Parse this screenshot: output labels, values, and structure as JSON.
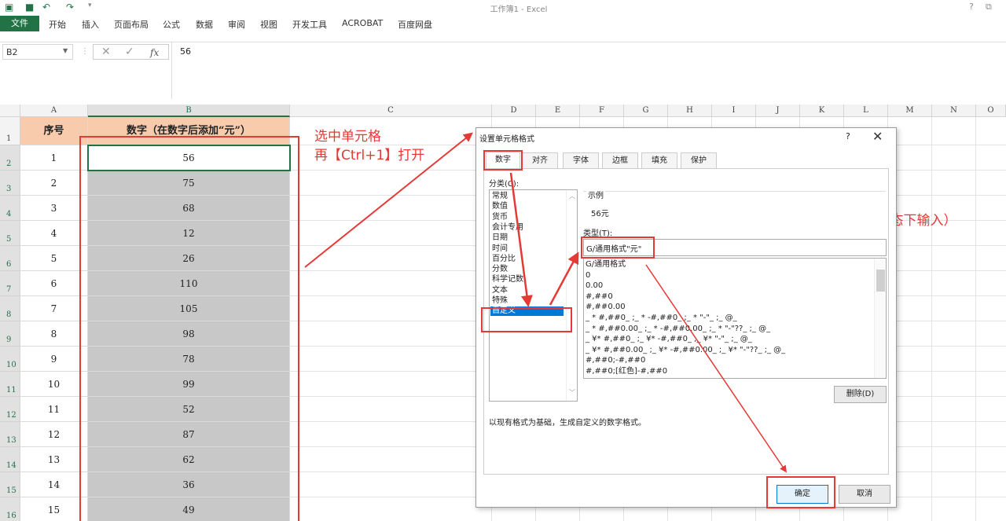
{
  "window": {
    "title": "工作簿1 - Excel"
  },
  "ribbon": {
    "tabs": [
      "文件",
      "开始",
      "插入",
      "页面布局",
      "公式",
      "数据",
      "审阅",
      "视图",
      "开发工具",
      "ACROBAT",
      "百度网盘"
    ]
  },
  "formula_bar": {
    "name_box": "B2",
    "value": "56",
    "fx": "fx"
  },
  "columns": [
    "A",
    "B",
    "C",
    "D",
    "E",
    "F",
    "G",
    "H",
    "I",
    "J",
    "K",
    "L",
    "M",
    "N",
    "O"
  ],
  "rows": [
    "1",
    "2",
    "3",
    "4",
    "5",
    "6",
    "7",
    "8",
    "9",
    "10",
    "11",
    "12",
    "13",
    "14",
    "15",
    "16"
  ],
  "table": {
    "header_a": "序号",
    "header_b": "数字（在数字后添加“元”）",
    "data": [
      {
        "a": "1",
        "b": "56"
      },
      {
        "a": "2",
        "b": "75"
      },
      {
        "a": "3",
        "b": "68"
      },
      {
        "a": "4",
        "b": "12"
      },
      {
        "a": "5",
        "b": "26"
      },
      {
        "a": "6",
        "b": "110"
      },
      {
        "a": "7",
        "b": "105"
      },
      {
        "a": "8",
        "b": "98"
      },
      {
        "a": "9",
        "b": "78"
      },
      {
        "a": "10",
        "b": "99"
      },
      {
        "a": "11",
        "b": "52"
      },
      {
        "a": "12",
        "b": "87"
      },
      {
        "a": "13",
        "b": "62"
      },
      {
        "a": "14",
        "b": "36"
      },
      {
        "a": "15",
        "b": "49"
      }
    ]
  },
  "annotations": {
    "line1": "选中单元格",
    "line2": "再【Ctrl+1】打开",
    "hint": "G/通用格式\"后缀内容\"（双引号为英文状态下输入）"
  },
  "dialog": {
    "title": "设置单元格格式",
    "help": "?",
    "close": "✕",
    "tabs": [
      "数字",
      "对齐",
      "字体",
      "边框",
      "填充",
      "保护"
    ],
    "category_label": "分类(C):",
    "categories": [
      "常规",
      "数值",
      "货币",
      "会计专用",
      "日期",
      "时间",
      "百分比",
      "分数",
      "科学记数",
      "文本",
      "特殊",
      "自定义"
    ],
    "selected_category": "自定义",
    "sample_label": "示例",
    "sample_value": "56元",
    "type_label": "类型(T):",
    "type_value": "G/通用格式\"元\"",
    "formats": [
      "G/通用格式",
      "0",
      "0.00",
      "#,##0",
      "#,##0.00",
      "_ * #,##0_ ;_ * -#,##0_ ;_ * \"-\"_ ;_ @_",
      "_ * #,##0.00_ ;_ * -#,##0.00_ ;_ * \"-\"??_ ;_ @_",
      "_ ¥* #,##0_ ;_ ¥* -#,##0_ ;_ ¥* \"-\"_ ;_ @_",
      "_ ¥* #,##0.00_ ;_ ¥* -#,##0.00_ ;_ ¥* \"-\"??_ ;_ @_",
      "#,##0;-#,##0",
      "#,##0;[红色]-#,##0"
    ],
    "delete_button": "删除(D)",
    "description": "以现有格式为基础，生成自定义的数字格式。",
    "ok_button": "确定",
    "cancel_button": "取消"
  },
  "colors": {
    "excel_green": "#217346",
    "annotation_red": "#e53935",
    "header_fill": "#f8cbad",
    "selection_gray": "#c8c8c8"
  }
}
